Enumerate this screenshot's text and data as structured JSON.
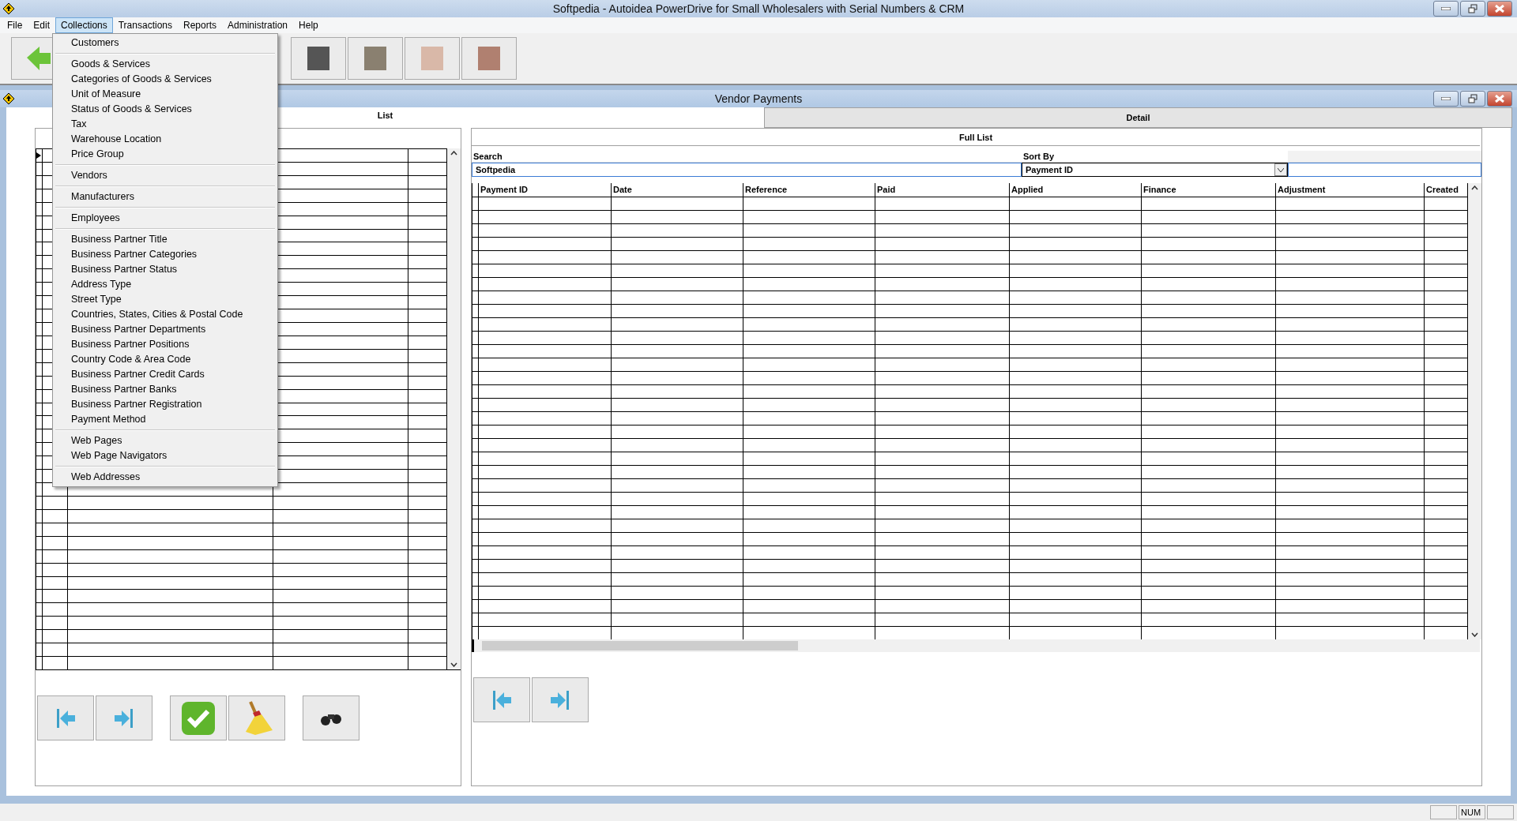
{
  "app_window": {
    "title": "Softpedia - Autoidea PowerDrive for Small Wholesalers with Serial Numbers & CRM"
  },
  "menu_bar": [
    {
      "label": "File",
      "selected": false
    },
    {
      "label": "Edit",
      "selected": false
    },
    {
      "label": "Collections",
      "selected": true
    },
    {
      "label": "Transactions",
      "selected": false
    },
    {
      "label": "Reports",
      "selected": false
    },
    {
      "label": "Administration",
      "selected": false
    },
    {
      "label": "Help",
      "selected": false
    }
  ],
  "toolbar": [
    {
      "kind": "back"
    },
    {
      "kind": "gap"
    },
    {
      "kind": "photo"
    },
    {
      "kind": "photo"
    },
    {
      "kind": "photo"
    },
    {
      "kind": "photo"
    }
  ],
  "collections_menu": {
    "groups": [
      [
        "Customers"
      ],
      [
        "Goods & Services",
        "Categories of Goods & Services",
        "Unit of Measure",
        "Status of Goods & Services",
        "Tax",
        "Warehouse Location",
        "Price Group"
      ],
      [
        "Vendors"
      ],
      [
        "Manufacturers"
      ],
      [
        "Employees"
      ],
      [
        "Business Partner Title",
        "Business Partner Categories",
        "Business Partner Status",
        "Address Type",
        "Street Type",
        "Countries, States, Cities & Postal Code",
        "Business Partner Departments",
        "Business Partner Positions",
        "Country Code & Area Code",
        "Business Partner Credit Cards",
        "Business Partner Banks",
        "Business Partner Registration",
        "Payment Method"
      ],
      [
        "Web Pages",
        "Web Page Navigators"
      ],
      [
        "Web Addresses"
      ]
    ]
  },
  "child_window": {
    "title": "Vendor Payments"
  },
  "tabs": [
    {
      "label": "List",
      "selected": true
    },
    {
      "label": "Detail",
      "selected": false
    }
  ],
  "left_panel": {
    "buttons": [
      {
        "kind": "first"
      },
      {
        "kind": "last"
      },
      {
        "kind": "gap"
      },
      {
        "kind": "save"
      },
      {
        "kind": "clear"
      },
      {
        "kind": "gap"
      },
      {
        "kind": "find"
      }
    ]
  },
  "right_panel": {
    "subtab": "Full List",
    "search": {
      "label": "Search",
      "value": "Softpedia"
    },
    "sort_by": {
      "label": "Sort By",
      "value": "Payment ID"
    },
    "columns": [
      "Payment ID",
      "Date",
      "Reference",
      "Paid",
      "Applied",
      "Finance",
      "Adjustment",
      "Created"
    ],
    "buttons": [
      {
        "kind": "first"
      },
      {
        "kind": "last"
      }
    ]
  },
  "status_bar": {
    "indicator": "NUM"
  }
}
